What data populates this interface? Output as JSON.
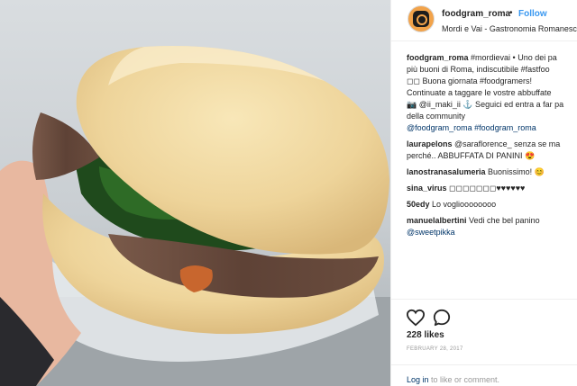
{
  "post": {
    "username": "foodgram_roma",
    "separator": "•",
    "follow_label": "Follow",
    "location": "Mordi e Vai - Gastronomia Romanesca",
    "caption": [
      {
        "user": "foodgram_roma",
        "text": " #mordievai • Uno dei pa"
      },
      {
        "text": "più buoni di Roma, indiscutibile #fastfoo"
      },
      {
        "text": "◻◻ Buona giornata #foodgramers!"
      },
      {
        "text": "Continuate a taggare le vostre abbuffate"
      },
      {
        "text": "📷 @ii_maki_ii ⚓ Seguici ed entra a far pa"
      },
      {
        "text": "della community"
      },
      {
        "text": "@foodgram_roma #foodgram_roma"
      }
    ],
    "comments": [
      {
        "user": "laurapelons",
        "text": " @saraflorence_ senza se ma",
        "line2": "perché.. ABBUFFATA DI PANINI 😍"
      },
      {
        "user": "lanostranasalumeria",
        "text": " Buonissimo! 😊"
      },
      {
        "user": "sina_virus",
        "text": " ◻◻◻◻◻◻◻♥♥♥♥♥♥"
      },
      {
        "user": "50edy",
        "text": " Lo voglioooooooo"
      },
      {
        "user": "manuelalbertini",
        "text": " Vedi che bel panino",
        "line2": "@sweetpikka"
      }
    ],
    "likes": "228 likes",
    "date": "FEBRUARY 28, 2017",
    "login_link": "Log in",
    "login_rest": " to like or comment."
  },
  "icons": {
    "like": "heart-icon",
    "comment": "comment-bubble-icon",
    "avatar": "instagram-camera-icon"
  },
  "colors": {
    "follow": "#3897f0",
    "link": "#003569",
    "muted": "#999999",
    "border": "#efefef"
  }
}
